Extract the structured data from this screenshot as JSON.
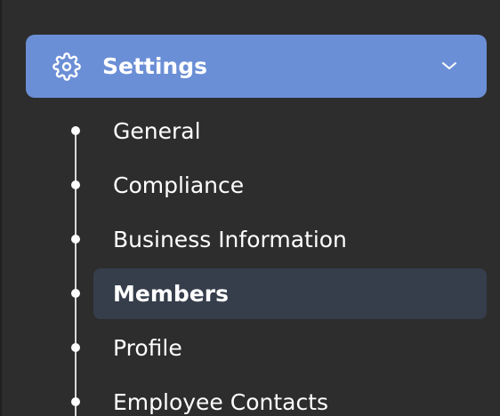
{
  "settings": {
    "label": "Settings",
    "icon": "gear-icon",
    "expand_icon": "chevron-down-icon",
    "accent_color": "#6b8fd6",
    "expanded": true
  },
  "sub_items": [
    {
      "label": "General",
      "active": false
    },
    {
      "label": "Compliance",
      "active": false
    },
    {
      "label": "Business Information",
      "active": false
    },
    {
      "label": "Members",
      "active": true
    },
    {
      "label": "Profile",
      "active": false
    },
    {
      "label": "Employee Contacts",
      "active": false
    }
  ],
  "colors": {
    "background": "#2d2d2d",
    "active_item": "#363e4c",
    "text": "#ffffff"
  }
}
